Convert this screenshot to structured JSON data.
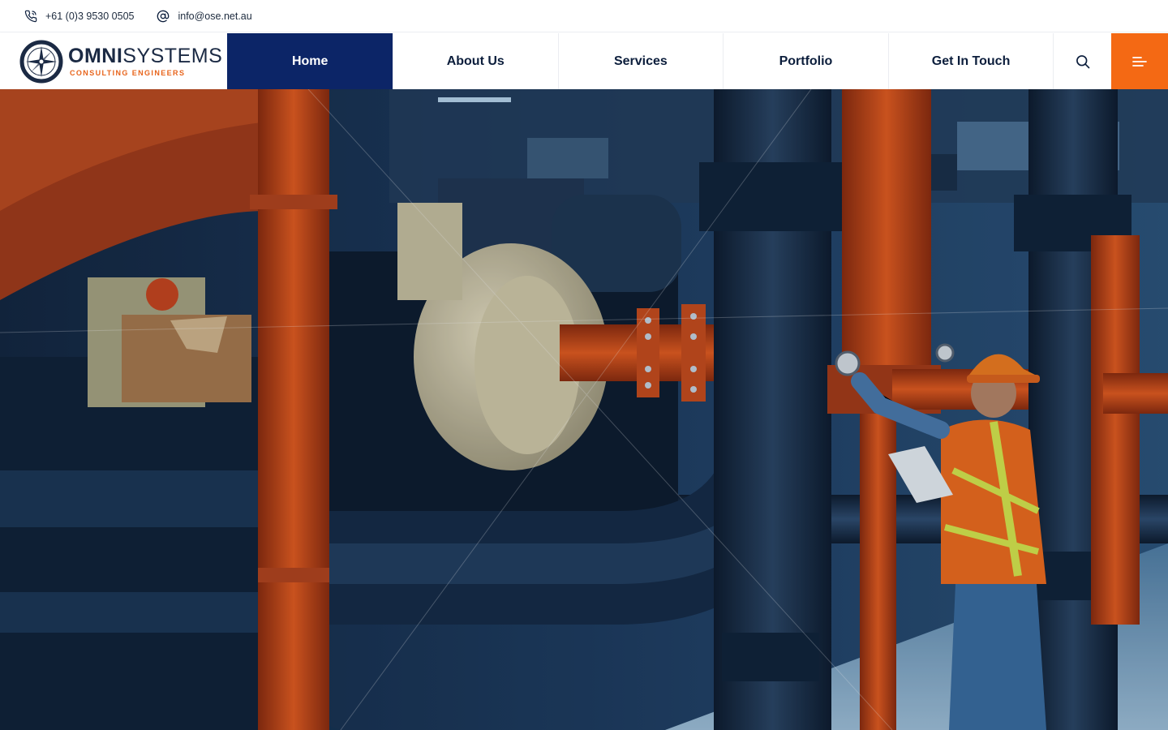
{
  "topbar": {
    "phone": "+61 (0)3 9530 0505",
    "email": "info@ose.net.au",
    "phone_icon": "phone-icon",
    "email_icon": "at-sign-icon"
  },
  "header": {
    "logo": {
      "brand_bold": "OMNI",
      "brand_light": "SYSTEMS",
      "tagline": "CONSULTING ENGINEERS"
    },
    "nav": [
      {
        "label": "Home",
        "active": true
      },
      {
        "label": "About Us",
        "active": false
      },
      {
        "label": "Services",
        "active": false
      },
      {
        "label": "Portfolio",
        "active": false
      },
      {
        "label": "Get In Touch",
        "active": false
      }
    ],
    "search_icon": "search-icon",
    "menu_icon": "menu-icon"
  },
  "hero": {
    "image": "industrial-plant-worker-photo"
  },
  "colors": {
    "primary_navy": "#0c2567",
    "accent_orange": "#f46914",
    "text_dark": "#0c1e3c"
  }
}
